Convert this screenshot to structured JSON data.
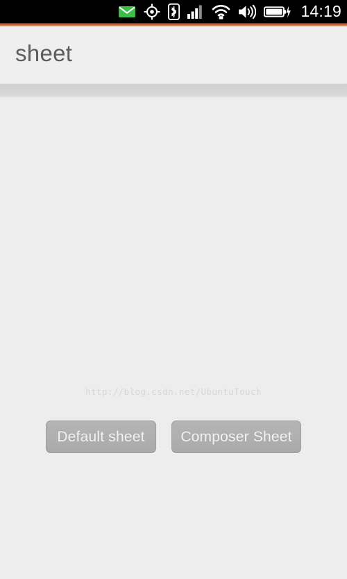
{
  "statusbar": {
    "time": "14:19",
    "icons": [
      {
        "name": "mail-icon",
        "label": "mail"
      },
      {
        "name": "location-icon",
        "label": "location"
      },
      {
        "name": "bluetooth-icon",
        "label": "bluetooth"
      },
      {
        "name": "cellular-signal-icon",
        "label": "cellular signal"
      },
      {
        "name": "wifi-secure-icon",
        "label": "wifi secured"
      },
      {
        "name": "volume-icon",
        "label": "volume"
      },
      {
        "name": "battery-charging-icon",
        "label": "battery charging"
      }
    ],
    "background": "#000000",
    "mail_color": "#3bbf48",
    "icon_color": "#ffffff",
    "time_color": "#ffffff"
  },
  "accent": {
    "dark": "#8f3a14",
    "light": "#e8854f"
  },
  "header": {
    "title": "sheet",
    "title_color": "#5c5c5c",
    "background": "#efefef"
  },
  "content": {
    "background": "#ededed",
    "watermark": "http://blog.csdn.net/UbuntuTouch",
    "watermark_color": "#d6d6d6",
    "buttons": [
      {
        "label": "Default sheet",
        "color": "#b0b0b0",
        "text_color": "#f2f2f2"
      },
      {
        "label": "Composer Sheet",
        "color": "#b0b0b0",
        "text_color": "#f2f2f2"
      }
    ]
  }
}
